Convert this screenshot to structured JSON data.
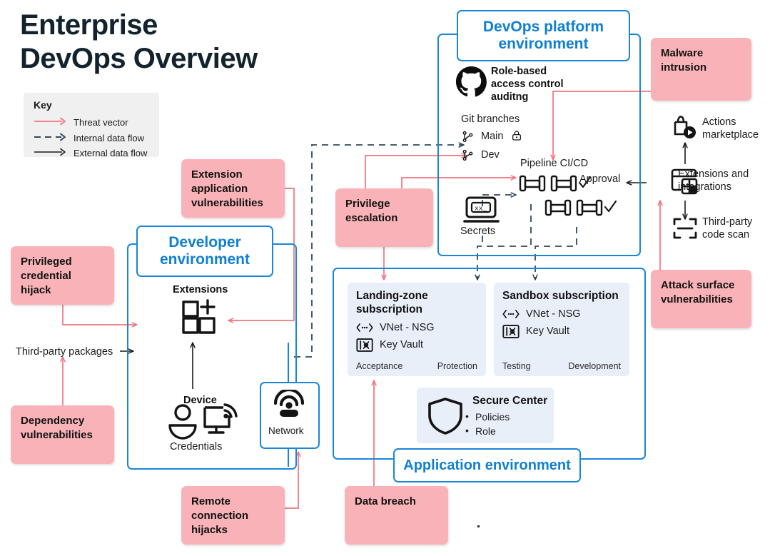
{
  "title": {
    "line1": "Enterprise",
    "line2": "DevOps Overview"
  },
  "colors": {
    "threat_pink": "#f9b3b8",
    "threat_line": "#f2737f",
    "env_blue": "#1a86db",
    "env_title_blue": "#0f7fd4",
    "card_blue": "#e8eff9",
    "internal_flow": "#2f4a5c",
    "external_flow": "#1a1a1a",
    "key_background": "#f0f0f0"
  },
  "key": {
    "title": "Key",
    "items": [
      {
        "label": "Threat vector",
        "style": "solid",
        "color": "#f2737f",
        "icon": "arrow-right-icon"
      },
      {
        "label": "Internal data flow",
        "style": "dashed",
        "color": "#2f4a5c",
        "icon": "arrow-right-icon"
      },
      {
        "label": "External data flow",
        "style": "solid",
        "color": "#1a1a1a",
        "icon": "arrow-right-icon"
      }
    ]
  },
  "environments": {
    "devops": {
      "tag": "DevOps platform environment",
      "rbac": {
        "icon": "github-icon",
        "label": "Role-based access control auditng"
      },
      "git_branches": {
        "heading": "Git branches",
        "items": [
          {
            "icon": "branch-icon",
            "label": "Main",
            "badge": "lock-icon"
          },
          {
            "icon": "branch-icon",
            "label": "Dev",
            "badge": ""
          }
        ]
      },
      "pipeline": {
        "label": "Pipeline CI/CD",
        "approval_label": "Approval",
        "stages": [
          {
            "row": 1,
            "nodes": 2,
            "check": true
          },
          {
            "row": 2,
            "nodes": 2,
            "check": true
          }
        ]
      },
      "secrets": {
        "icon": "console-secrets-icon",
        "label": "Secrets"
      }
    },
    "developer": {
      "tag": "Developer environment",
      "extensions": {
        "icon": "extensions-add-icon",
        "label": "Extensions"
      },
      "device": {
        "icon": "device-icon",
        "label": "Device"
      },
      "credentials": {
        "icon": "person-icon",
        "label": "Credentials"
      },
      "network": {
        "icon": "network-icon",
        "label": "Network"
      }
    },
    "application": {
      "tag": "Application environment",
      "subscriptions": [
        {
          "name": "Landing-zone subscription",
          "resources": [
            {
              "icon": "vnet-icon",
              "label": "VNet - NSG"
            },
            {
              "icon": "keyvault-icon",
              "label": "Key Vault"
            }
          ],
          "footer_left": "Acceptance",
          "footer_right": "Protection"
        },
        {
          "name": "Sandbox subscription",
          "resources": [
            {
              "icon": "vnet-icon",
              "label": "VNet - NSG"
            },
            {
              "icon": "keyvault-icon",
              "label": "Key Vault"
            }
          ],
          "footer_left": "Testing",
          "footer_right": "Development"
        }
      ],
      "secure_center": {
        "icon": "shield-icon",
        "title": "Secure Center",
        "bullets": [
          "Policies",
          "Role"
        ]
      }
    }
  },
  "marketplace": {
    "actions": {
      "icon": "marketplace-icon",
      "label": "Actions marketplace"
    },
    "extensions_integrations": {
      "icon": "extensions-integrations-icon",
      "label": "Extensions and integrations"
    },
    "code_scan": {
      "icon": "scan-icon",
      "label": "Third-party code scan"
    }
  },
  "external_flows": {
    "third_party_packages": "Third-party packages"
  },
  "threats": [
    {
      "id": "malware",
      "label": "Malware intrusion"
    },
    {
      "id": "extension-application",
      "label": "Extension application vulnerabilities"
    },
    {
      "id": "privilege-escalation",
      "label": "Privilege escalation"
    },
    {
      "id": "privileged-credential",
      "label": "Privileged credential hijack"
    },
    {
      "id": "attack-surface",
      "label": "Attack surface vulnerabilities"
    },
    {
      "id": "dependency",
      "label": "Dependency vulnerabilities"
    },
    {
      "id": "remote-connection",
      "label": "Remote connection hijacks"
    },
    {
      "id": "data-breach",
      "label": "Data breach"
    }
  ]
}
